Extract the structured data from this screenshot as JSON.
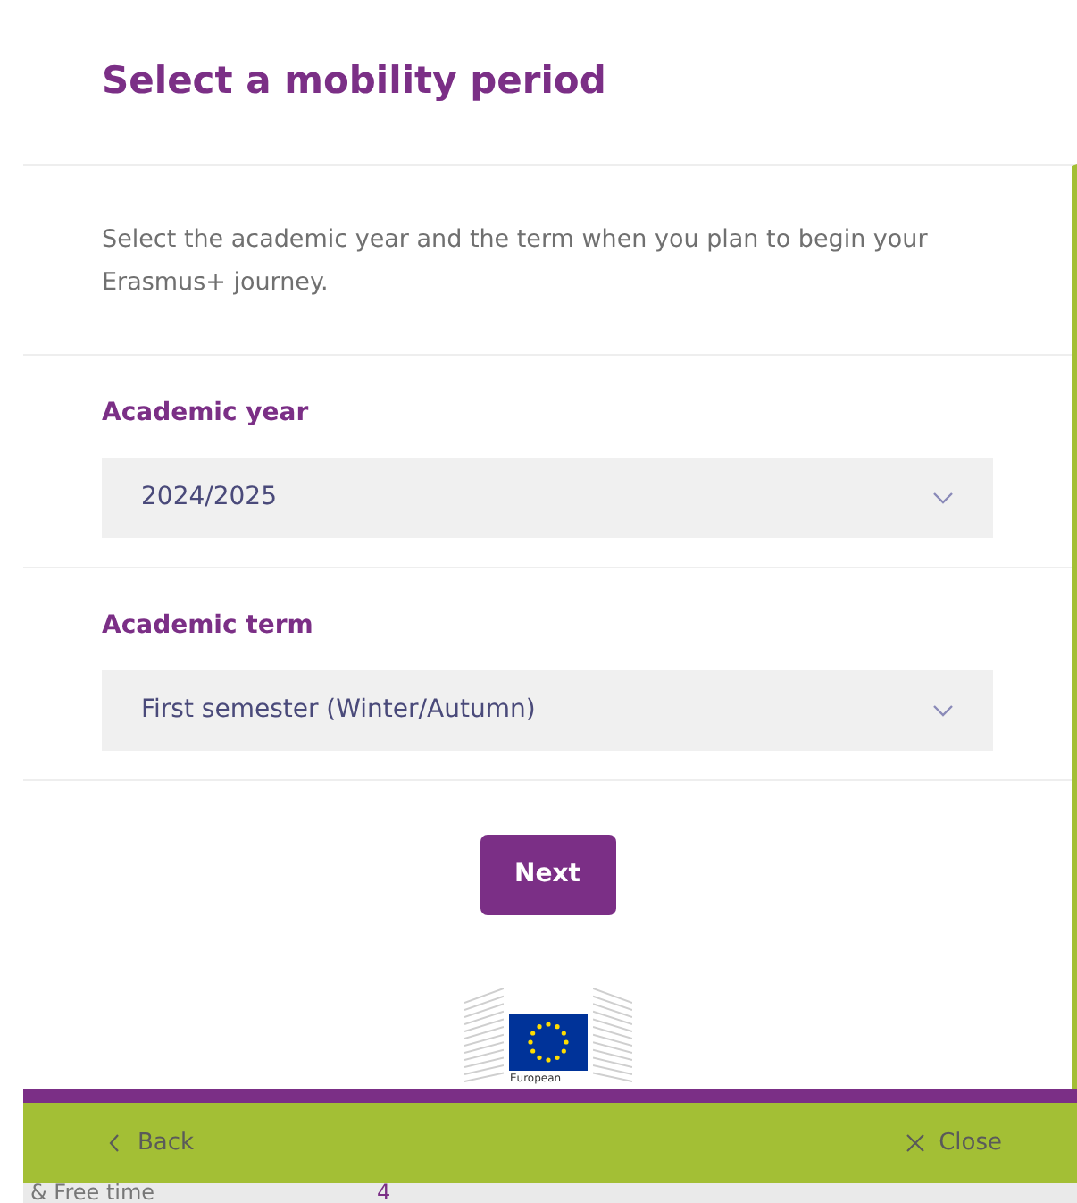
{
  "title": "Select a mobility period",
  "intro": "Select the academic year and the term when you plan to begin your Erasmus+ journey.",
  "fields": [
    {
      "label": "Academic year",
      "value": "2024/2025"
    },
    {
      "label": "Academic term",
      "value": "First semester (Winter/Autumn)"
    }
  ],
  "next_button": "Next",
  "logo": {
    "caption": "European"
  },
  "footer": {
    "back": "Back",
    "close": "Close"
  },
  "background_row": {
    "label": "& Free time",
    "count": "4"
  }
}
